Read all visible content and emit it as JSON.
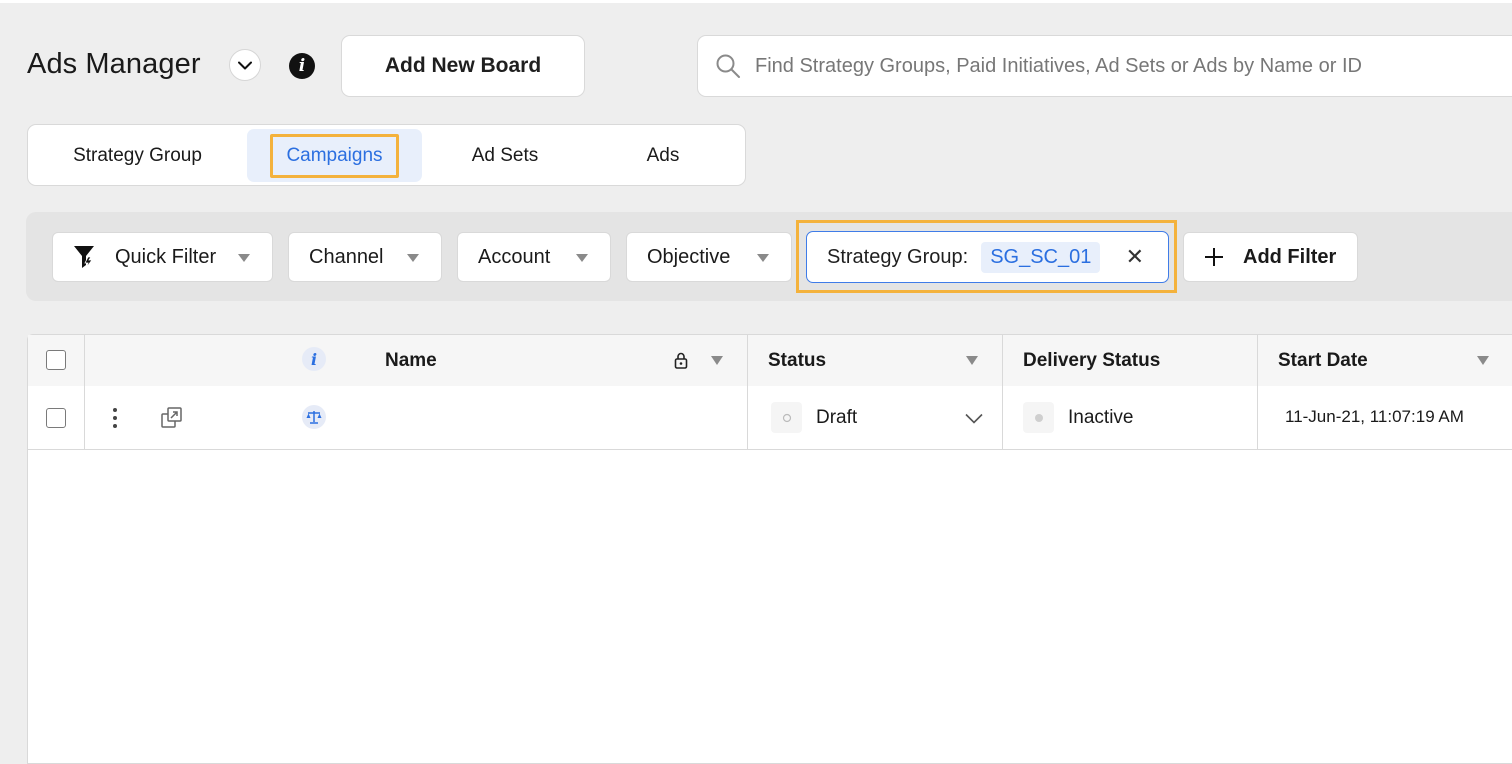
{
  "header": {
    "title": "Ads Manager",
    "add_board_label": "Add New Board",
    "info_glyph": "i",
    "search_placeholder": "Find Strategy Groups, Paid Initiatives, Ad Sets or Ads by Name or ID"
  },
  "tabs": [
    {
      "label": "Strategy Group",
      "active": false
    },
    {
      "label": "Campaigns",
      "active": true
    },
    {
      "label": "Ad Sets",
      "active": false
    },
    {
      "label": "Ads",
      "active": false
    }
  ],
  "filters": {
    "quick_filter": "Quick Filter",
    "channel": "Channel",
    "account": "Account",
    "objective": "Objective",
    "strategy_group_label": "Strategy Group:",
    "strategy_group_value": "SG_SC_01",
    "add_filter": "Add Filter"
  },
  "table": {
    "columns": {
      "info_glyph": "i",
      "name": "Name",
      "status": "Status",
      "delivery_status": "Delivery Status",
      "start_date": "Start Date"
    },
    "rows": [
      {
        "name": "",
        "status": "Draft",
        "delivery_status": "Inactive",
        "start_date": "11-Jun-21, 11:07:19 AM"
      }
    ]
  },
  "colors": {
    "accent": "#2b6fe0",
    "highlight": "#f4b23c",
    "active_tab_bg": "#e8effb"
  },
  "icons": [
    "chevron-down-icon",
    "info-icon",
    "search-icon",
    "lightning-filter-icon",
    "close-icon",
    "plus-icon",
    "lock-icon",
    "kebab-menu-icon",
    "open-external-icon",
    "balance-scale-icon"
  ]
}
